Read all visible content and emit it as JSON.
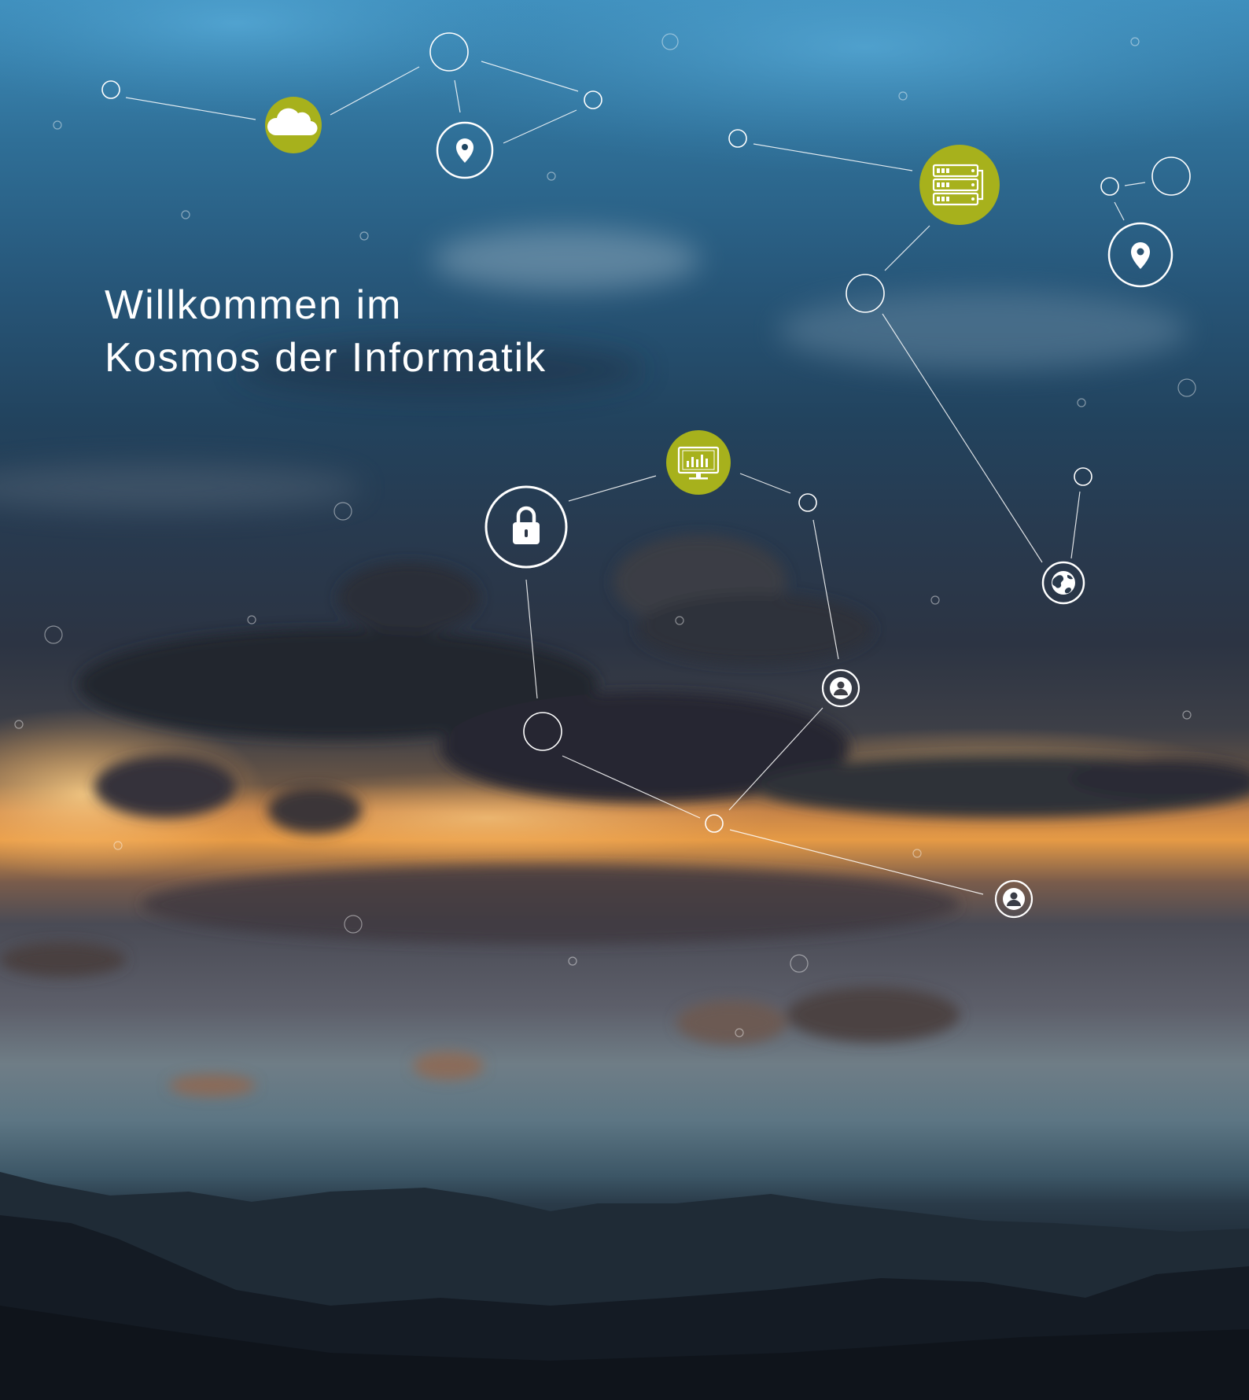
{
  "headline": {
    "line1": "Willkommen im",
    "line2": "Kosmos der Informatik"
  },
  "colors": {
    "accent": "#a7b11c",
    "line": "#ffffff",
    "text": "#ffffff"
  },
  "icons": [
    "cloud-icon",
    "location-pin-icon",
    "server-icon",
    "location-pin-icon",
    "lock-icon",
    "monitor-chart-icon",
    "globe-icon",
    "user-icon",
    "user-icon"
  ]
}
